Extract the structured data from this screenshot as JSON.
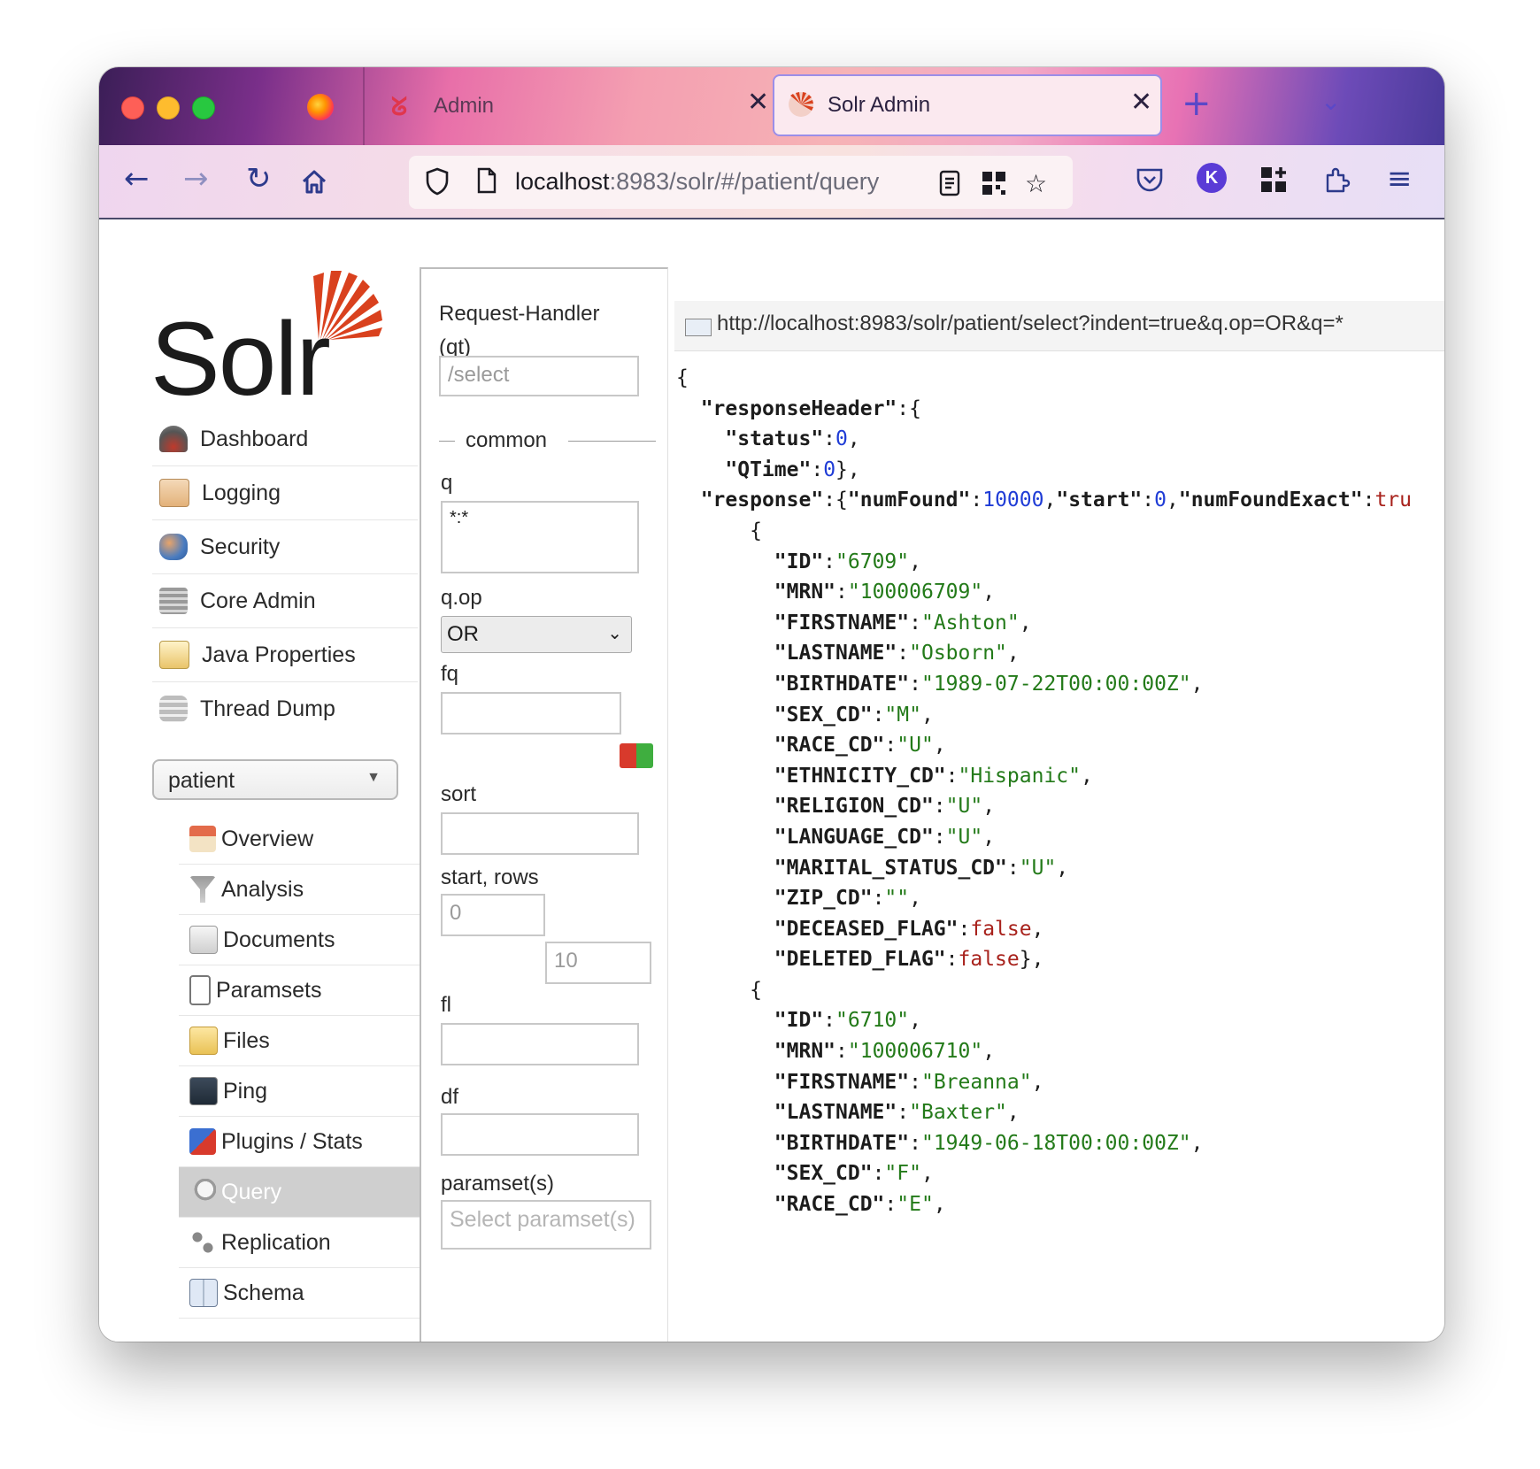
{
  "browser": {
    "tabs": [
      {
        "title": "Admin",
        "active": false
      },
      {
        "title": "Solr Admin",
        "active": true
      }
    ],
    "url_host": "localhost",
    "url_rest": ":8983/solr/#/patient/query",
    "avatar_letter": "K"
  },
  "brand": {
    "name": "Solr",
    "color": "#d9411e"
  },
  "nav": {
    "items": [
      {
        "label": "Dashboard",
        "icon": "dashboard-icon"
      },
      {
        "label": "Logging",
        "icon": "logging-icon"
      },
      {
        "label": "Security",
        "icon": "security-icon"
      },
      {
        "label": "Core Admin",
        "icon": "core-admin-icon"
      },
      {
        "label": "Java Properties",
        "icon": "java-properties-icon"
      },
      {
        "label": "Thread Dump",
        "icon": "thread-dump-icon"
      }
    ],
    "core_selector": "patient",
    "core_items": [
      {
        "label": "Overview",
        "icon": "home-icon"
      },
      {
        "label": "Analysis",
        "icon": "funnel-icon"
      },
      {
        "label": "Documents",
        "icon": "documents-icon"
      },
      {
        "label": "Paramsets",
        "icon": "paramsets-icon"
      },
      {
        "label": "Files",
        "icon": "folder-icon"
      },
      {
        "label": "Ping",
        "icon": "ping-icon"
      },
      {
        "label": "Plugins / Stats",
        "icon": "plugins-icon"
      },
      {
        "label": "Query",
        "icon": "magnifier-icon",
        "active": true
      },
      {
        "label": "Replication",
        "icon": "replication-icon"
      },
      {
        "label": "Schema",
        "icon": "schema-icon"
      }
    ]
  },
  "form": {
    "request_handler_label": "Request-Handler (qt)",
    "request_handler_value": "/select",
    "section_common": "common",
    "q_label": "q",
    "q_value": "*:*",
    "qop_label": "q.op",
    "qop_value": "OR",
    "fq_label": "fq",
    "fq_value": "",
    "sort_label": "sort",
    "sort_value": "",
    "start_rows_label": "start, rows",
    "start_value": "0",
    "rows_value": "10",
    "fl_label": "fl",
    "fl_value": "",
    "df_label": "df",
    "df_value": "",
    "paramsets_label": "paramset(s)",
    "paramsets_placeholder": "Select paramset(s)"
  },
  "result": {
    "request_url": "http://localhost:8983/solr/patient/select?indent=true&q.op=OR&q=*",
    "responseHeader": {
      "status": 0,
      "QTime": 0
    },
    "response": {
      "numFound": 10000,
      "start": 0,
      "numFoundExact": "tru"
    },
    "docs": [
      {
        "ID": "6709",
        "MRN": "100006709",
        "FIRSTNAME": "Ashton",
        "LASTNAME": "Osborn",
        "BIRTHDATE": "1989-07-22T00:00:00Z",
        "SEX_CD": "M",
        "RACE_CD": "U",
        "ETHNICITY_CD": "Hispanic",
        "RELIGION_CD": "U",
        "LANGUAGE_CD": "U",
        "MARITAL_STATUS_CD": "U",
        "ZIP_CD": "",
        "DECEASED_FLAG": false,
        "DELETED_FLAG": false
      },
      {
        "ID": "6710",
        "MRN": "100006710",
        "FIRSTNAME": "Breanna",
        "LASTNAME": "Baxter",
        "BIRTHDATE": "1949-06-18T00:00:00Z",
        "SEX_CD": "F",
        "RACE_CD": "E"
      }
    ]
  }
}
